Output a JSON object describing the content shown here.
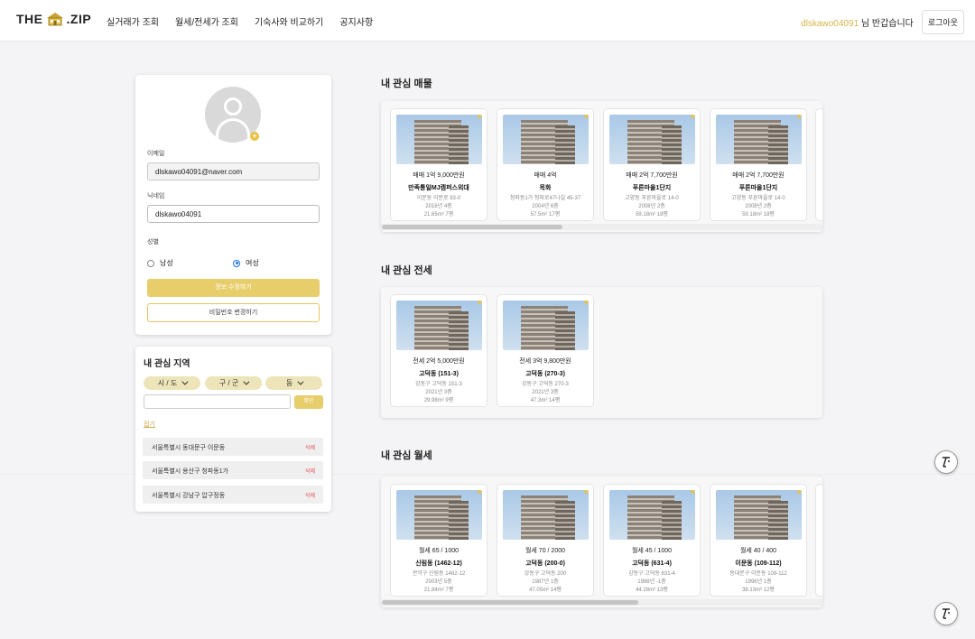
{
  "header": {
    "logo_left": "THE",
    "logo_right": ".ZIP",
    "nav": [
      "실거래가 조회",
      "월세/전세가 조회",
      "기숙사와 비교하기",
      "공지사항"
    ],
    "username": "dlskawo04091",
    "greeting": "님 반갑습니다",
    "logout": "로그아웃"
  },
  "profile": {
    "avatar_plus": "+",
    "email_label": "이메일",
    "email_value": "dlskawo04091@naver.com",
    "nickname_label": "닉네임",
    "nickname_value": "dlskawo04091",
    "gender_label": "성별",
    "male": "남성",
    "female": "여성",
    "selected_gender": "female",
    "update_button": "정보 수정하기",
    "password_button": "비밀번호 변경하기"
  },
  "regions": {
    "title": "내 관심 지역",
    "dropdowns": [
      "시 / 도",
      "구 / 군",
      "동"
    ],
    "confirm": "확인",
    "reset": "접기",
    "items": [
      {
        "name": "서울특별시 동대문구 이문동",
        "action": "삭제"
      },
      {
        "name": "서울특별시 용산구 청파동1가",
        "action": "삭제"
      },
      {
        "name": "서울특별시 강남구 압구정동",
        "action": "삭제"
      }
    ]
  },
  "sale": {
    "title": "내 관심 매물",
    "items": [
      {
        "price": "매매 1억 9,000만원",
        "name": "만족통일MJ캠퍼스외대",
        "addr": "이문동 이문로 93-0",
        "year": "2016년 4층",
        "area": "21.65m² 7평"
      },
      {
        "price": "매매 4억",
        "name": "목화",
        "addr": "청파동1가 청파로47나길 45-37",
        "year": "2004년 6층",
        "area": "57.5m² 17평"
      },
      {
        "price": "매매 2억 7,700만원",
        "name": "푸른마을1단지",
        "addr": "고양동 푸른마을로 14-0",
        "year": "2008년 2층",
        "area": "59.18m² 18평"
      },
      {
        "price": "매매 2억 7,700만원",
        "name": "푸른마을1단지",
        "addr": "고양동 푸른마을로 14-0",
        "year": "2008년 2층",
        "area": "59.18m² 18평"
      }
    ],
    "scroll_fraction": 0.41
  },
  "jeonse": {
    "title": "내 관심 전세",
    "items": [
      {
        "price": "전세 2억 5,000만원",
        "name": "고덕동 (151-3)",
        "addr": "강동구 고덕동 151-3",
        "year": "2021년 3층",
        "area": "29.98m² 9평"
      },
      {
        "price": "전세 3억 9,800만원",
        "name": "고덕동 (270-3)",
        "addr": "강동구 고덕동 270-3",
        "year": "2021년 3층",
        "area": "47.3m² 14평"
      }
    ]
  },
  "monthly": {
    "title": "내 관심 월세",
    "items": [
      {
        "price": "월세 65 / 1000",
        "name": "신림동 (1462-12)",
        "addr": "관악구 신림동 1462-12",
        "year": "2003년 5층",
        "area": "21.84m² 7평"
      },
      {
        "price": "월세 70 / 2000",
        "name": "고덕동 (200-0)",
        "addr": "강동구 고덕동 200",
        "year": "1987년 1층",
        "area": "47.05m² 14평"
      },
      {
        "price": "월세 45 / 1000",
        "name": "고덕동 (631-4)",
        "addr": "강동구 고덕동 631-4",
        "year": "1988년 -1층",
        "area": "44.28m² 13평"
      },
      {
        "price": "월세 40 / 400",
        "name": "이문동 (109-112)",
        "addr": "동대문구 이문동 109-112",
        "year": "1996년 1층",
        "area": "38.13m² 12평"
      }
    ],
    "scroll_fraction": 0.58
  },
  "colors": {
    "accent": "#e8cd6b",
    "username": "#d6b547",
    "heart": "#e8c34a",
    "delete": "#e24b4b"
  },
  "icons": [
    "logo-house-icon",
    "plus-icon",
    "chevron-down-icon",
    "heart-icon",
    "wand-icon"
  ]
}
